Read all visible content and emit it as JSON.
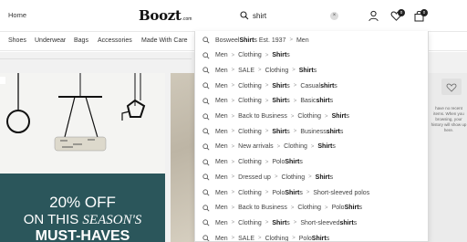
{
  "header": {
    "home_label": "Home",
    "logo_text": "Boozt",
    "logo_suffix": ".com",
    "search_query": "shirt",
    "clear_icon": "×",
    "wishlist_count": "0",
    "cart_count": "0"
  },
  "nav": {
    "categories": [
      "Shoes",
      "Underwear",
      "Bags",
      "Accessories",
      "Made With Care"
    ]
  },
  "banner": {
    "promo_line1": "20% OFF",
    "promo_line2_prefix": "ON THIS ",
    "promo_line2_italic": "SEASON'S",
    "promo_line3": "MUST-HAVES"
  },
  "side_panel": {
    "text": "have no recent items. When you browsing, your history will show up here."
  },
  "suggestions": [
    [
      [
        "Bosweel ",
        false
      ],
      [
        "Shirt",
        true
      ],
      [
        "s Est. 1937",
        false
      ],
      [
        "|",
        false
      ],
      [
        "Men",
        false
      ]
    ],
    [
      [
        "Men",
        false
      ],
      [
        "|",
        false
      ],
      [
        "Clothing",
        false
      ],
      [
        "|",
        false
      ],
      [
        "Shirt",
        true
      ],
      [
        "s",
        false
      ]
    ],
    [
      [
        "Men",
        false
      ],
      [
        "|",
        false
      ],
      [
        "SALE",
        false
      ],
      [
        "|",
        false
      ],
      [
        "Clothing",
        false
      ],
      [
        "|",
        false
      ],
      [
        "Shirt",
        true
      ],
      [
        "s",
        false
      ]
    ],
    [
      [
        "Men",
        false
      ],
      [
        "|",
        false
      ],
      [
        "Clothing",
        false
      ],
      [
        "|",
        false
      ],
      [
        "Shirt",
        true
      ],
      [
        "s",
        false
      ],
      [
        "|",
        false
      ],
      [
        "Casual ",
        false
      ],
      [
        "shirt",
        true
      ],
      [
        "s",
        false
      ]
    ],
    [
      [
        "Men",
        false
      ],
      [
        "|",
        false
      ],
      [
        "Clothing",
        false
      ],
      [
        "|",
        false
      ],
      [
        "Shirt",
        true
      ],
      [
        "s",
        false
      ],
      [
        "|",
        false
      ],
      [
        "Basic ",
        false
      ],
      [
        "shirt",
        true
      ],
      [
        "s",
        false
      ]
    ],
    [
      [
        "Men",
        false
      ],
      [
        "|",
        false
      ],
      [
        "Back to Business",
        false
      ],
      [
        "|",
        false
      ],
      [
        "Clothing",
        false
      ],
      [
        "|",
        false
      ],
      [
        "Shirt",
        true
      ],
      [
        "s",
        false
      ]
    ],
    [
      [
        "Men",
        false
      ],
      [
        "|",
        false
      ],
      [
        "Clothing",
        false
      ],
      [
        "|",
        false
      ],
      [
        "Shirt",
        true
      ],
      [
        "s",
        false
      ],
      [
        "|",
        false
      ],
      [
        "Business ",
        false
      ],
      [
        "shirt",
        true
      ],
      [
        "s",
        false
      ]
    ],
    [
      [
        "Men",
        false
      ],
      [
        "|",
        false
      ],
      [
        "New arrivals",
        false
      ],
      [
        "|",
        false
      ],
      [
        "Clothing",
        false
      ],
      [
        "|",
        false
      ],
      [
        "Shirt",
        true
      ],
      [
        "s",
        false
      ]
    ],
    [
      [
        "Men",
        false
      ],
      [
        "|",
        false
      ],
      [
        "Clothing",
        false
      ],
      [
        "|",
        false
      ],
      [
        "Polo ",
        false
      ],
      [
        "Shirt",
        true
      ],
      [
        "s",
        false
      ]
    ],
    [
      [
        "Men",
        false
      ],
      [
        "|",
        false
      ],
      [
        "Dressed up",
        false
      ],
      [
        "|",
        false
      ],
      [
        "Clothing",
        false
      ],
      [
        "|",
        false
      ],
      [
        "Shirt",
        true
      ],
      [
        "s",
        false
      ]
    ],
    [
      [
        "Men",
        false
      ],
      [
        "|",
        false
      ],
      [
        "Clothing",
        false
      ],
      [
        "|",
        false
      ],
      [
        "Polo ",
        false
      ],
      [
        "Shirt",
        true
      ],
      [
        "s",
        false
      ],
      [
        "|",
        false
      ],
      [
        "Short-sleeved polos",
        false
      ]
    ],
    [
      [
        "Men",
        false
      ],
      [
        "|",
        false
      ],
      [
        "Back to Business",
        false
      ],
      [
        "|",
        false
      ],
      [
        "Clothing",
        false
      ],
      [
        "|",
        false
      ],
      [
        "Polo ",
        false
      ],
      [
        "Shirt",
        true
      ],
      [
        "s",
        false
      ]
    ],
    [
      [
        "Men",
        false
      ],
      [
        "|",
        false
      ],
      [
        "Clothing",
        false
      ],
      [
        "|",
        false
      ],
      [
        "Shirt",
        true
      ],
      [
        "s",
        false
      ],
      [
        "|",
        false
      ],
      [
        "Short-sleeved ",
        false
      ],
      [
        "shirt",
        true
      ],
      [
        "s",
        false
      ]
    ],
    [
      [
        "Men",
        false
      ],
      [
        "|",
        false
      ],
      [
        "SALE",
        false
      ],
      [
        "|",
        false
      ],
      [
        "Clothing",
        false
      ],
      [
        "|",
        false
      ],
      [
        "Polo ",
        false
      ],
      [
        "Shirt",
        true
      ],
      [
        "s",
        false
      ]
    ]
  ],
  "separator_glyph": ">"
}
